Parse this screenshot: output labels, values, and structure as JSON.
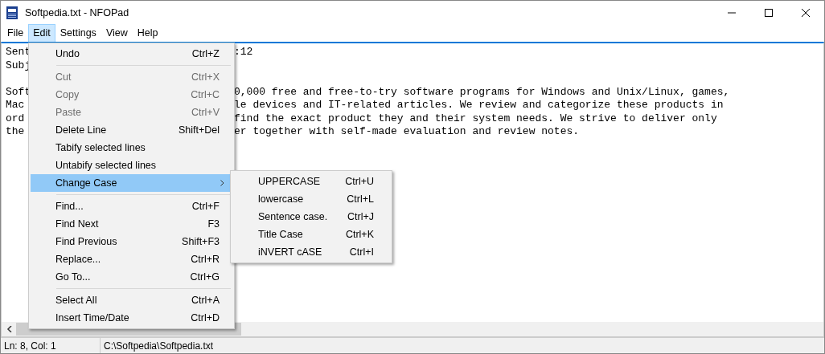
{
  "window": {
    "title": "Softpedia.txt - NFOPad"
  },
  "menubar": [
    {
      "label": "File",
      "selected": false
    },
    {
      "label": "Edit",
      "selected": true
    },
    {
      "label": "Settings",
      "selected": false
    },
    {
      "label": "View",
      "selected": false
    },
    {
      "label": "Help",
      "selected": false
    }
  ],
  "editor": {
    "paragraphs": [
      [
        {
          "left": "Sent",
          "right": ":12"
        },
        {
          "left": "Subj"
        }
      ],
      [
        {
          "left": "Soft",
          "right": "0,000 free and free-to-try software programs for Windows and Unix/Linux, games,"
        },
        {
          "left": "Mac",
          "right": "le devices and IT-related articles. We review and categorize these products in"
        },
        {
          "left": "ord",
          "right": "find the exact product they and their system needs. We strive to deliver only"
        },
        {
          "left": "the",
          "right": "er together with self-made evaluation and review notes."
        }
      ]
    ]
  },
  "edit_menu": [
    {
      "kind": "item",
      "label": "Undo",
      "shortcut": "Ctrl+Z",
      "disabled": false,
      "selected": false
    },
    {
      "kind": "separator"
    },
    {
      "kind": "item",
      "label": "Cut",
      "shortcut": "Ctrl+X",
      "disabled": true,
      "selected": false
    },
    {
      "kind": "item",
      "label": "Copy",
      "shortcut": "Ctrl+C",
      "disabled": true,
      "selected": false
    },
    {
      "kind": "item",
      "label": "Paste",
      "shortcut": "Ctrl+V",
      "disabled": true,
      "selected": false
    },
    {
      "kind": "item",
      "label": "Delete Line",
      "shortcut": "Shift+Del",
      "disabled": false,
      "selected": false
    },
    {
      "kind": "item",
      "label": "Tabify selected lines",
      "disabled": false,
      "selected": false
    },
    {
      "kind": "item",
      "label": "Untabify selected lines",
      "disabled": false,
      "selected": false
    },
    {
      "kind": "submenu",
      "label": "Change Case",
      "disabled": false,
      "selected": true
    },
    {
      "kind": "separator"
    },
    {
      "kind": "item",
      "label": "Find...",
      "shortcut": "Ctrl+F",
      "disabled": false,
      "selected": false
    },
    {
      "kind": "item",
      "label": "Find Next",
      "shortcut": "F3",
      "disabled": false,
      "selected": false
    },
    {
      "kind": "item",
      "label": "Find Previous",
      "shortcut": "Shift+F3",
      "disabled": false,
      "selected": false
    },
    {
      "kind": "item",
      "label": "Replace...",
      "shortcut": "Ctrl+R",
      "disabled": false,
      "selected": false
    },
    {
      "kind": "item",
      "label": "Go To...",
      "shortcut": "Ctrl+G",
      "disabled": false,
      "selected": false
    },
    {
      "kind": "separator"
    },
    {
      "kind": "item",
      "label": "Select All",
      "shortcut": "Ctrl+A",
      "disabled": false,
      "selected": false
    },
    {
      "kind": "item",
      "label": "Insert Time/Date",
      "shortcut": "Ctrl+D",
      "disabled": false,
      "selected": false
    }
  ],
  "change_case_menu": [
    {
      "label": "UPPERCASE",
      "shortcut": "Ctrl+U"
    },
    {
      "label": "lowercase",
      "shortcut": "Ctrl+L"
    },
    {
      "label": "Sentence case.",
      "shortcut": "Ctrl+J"
    },
    {
      "label": "Title Case",
      "shortcut": "Ctrl+K"
    },
    {
      "label": "iNVERT cASE",
      "shortcut": "Ctrl+I"
    }
  ],
  "status_bar": {
    "position": "Ln: 8, Col: 1",
    "path": "C:\\Softpedia\\Softpedia.txt"
  }
}
